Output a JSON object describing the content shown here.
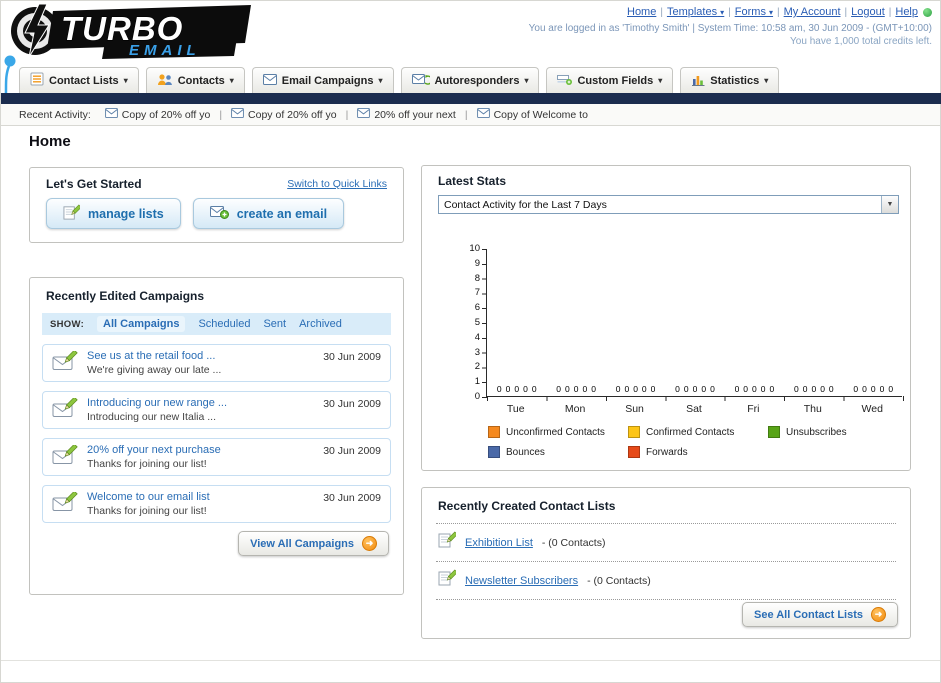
{
  "colors": {
    "navbar_dark": "#1b2c4e",
    "link_blue": "#2a6db5",
    "accent_orange": "#f28b0e",
    "filter_bar_bg": "#d9ecf9",
    "panel_border": "#c2c2be"
  },
  "icons": {
    "caret_down": "▾",
    "select_arrow": "▼",
    "arrow_right": "➜",
    "pipe": "|"
  },
  "header": {
    "logo_top": "TURBO",
    "logo_bottom": "EMAIL",
    "links": [
      "Home",
      "Templates",
      "Forms",
      "My Account",
      "Logout",
      "Help"
    ],
    "login_status": "You are logged in as 'Timothy Smith' | System Time: 10:58 am, 30 Jun 2009 - (GMT+10:00)",
    "credits": "You have 1,000 total credits left."
  },
  "nav": {
    "tabs": [
      {
        "label": "Contact Lists"
      },
      {
        "label": "Contacts"
      },
      {
        "label": "Email Campaigns"
      },
      {
        "label": "Autoresponders"
      },
      {
        "label": "Custom Fields"
      },
      {
        "label": "Statistics"
      }
    ]
  },
  "recent_activity": {
    "label": "Recent Activity:",
    "items": [
      {
        "text": "Copy of 20% off yo"
      },
      {
        "text": "Copy of 20% off yo"
      },
      {
        "text": "20% off your next"
      },
      {
        "text": "Copy of Welcome to"
      }
    ]
  },
  "page": {
    "title": "Home"
  },
  "get_started": {
    "title": "Let's Get Started",
    "switch_link": "Switch to Quick Links",
    "manage_lists_button": "manage lists",
    "create_email_button": "create an email"
  },
  "campaigns": {
    "title": "Recently Edited Campaigns",
    "show_label": "SHOW:",
    "filters": [
      "All Campaigns",
      "Scheduled",
      "Sent",
      "Archived"
    ],
    "items": [
      {
        "title": "See us at the retail food ...",
        "subtitle": "We're giving away our late ...",
        "date": "30 Jun 2009"
      },
      {
        "title": "Introducing our new range ...",
        "subtitle": "Introducing our new Italia ...",
        "date": "30 Jun 2009"
      },
      {
        "title": "20% off your next purchase",
        "subtitle": "Thanks for joining our list!",
        "date": "30 Jun 2009"
      },
      {
        "title": "Welcome to our email list",
        "subtitle": "Thanks for joining our list!",
        "date": "30 Jun 2009"
      }
    ],
    "view_all_button": "View All Campaigns"
  },
  "stats": {
    "title": "Latest Stats",
    "dropdown_value": "Contact Activity for the Last 7 Days"
  },
  "chart_data": {
    "type": "bar",
    "title": "Contact Activity for the Last 7 Days",
    "categories": [
      "Tue",
      "Mon",
      "Sun",
      "Sat",
      "Fri",
      "Thu",
      "Wed"
    ],
    "series": [
      {
        "name": "Unconfirmed Contacts",
        "color": "#f5891f",
        "values": [
          0,
          0,
          0,
          0,
          0,
          0,
          0
        ]
      },
      {
        "name": "Confirmed Contacts",
        "color": "#fdc517",
        "values": [
          0,
          0,
          0,
          0,
          0,
          0,
          0
        ]
      },
      {
        "name": "Unsubscribes",
        "color": "#58a417",
        "values": [
          0,
          0,
          0,
          0,
          0,
          0,
          0
        ]
      },
      {
        "name": "Bounces",
        "color": "#4a69a8",
        "values": [
          0,
          0,
          0,
          0,
          0,
          0,
          0
        ]
      },
      {
        "name": "Forwards",
        "color": "#e64a19",
        "values": [
          0,
          0,
          0,
          0,
          0,
          0,
          0
        ]
      }
    ],
    "xlabel": "",
    "ylabel": "",
    "ylim": [
      0,
      10
    ],
    "ytick_step": 1,
    "grid": false,
    "legend_position": "bottom",
    "value_labels_shown": true
  },
  "contact_lists": {
    "title": "Recently Created Contact Lists",
    "items": [
      {
        "name": "Exhibition List",
        "suffix": "- (0 Contacts)"
      },
      {
        "name": "Newsletter Subscribers",
        "suffix": "- (0 Contacts)"
      }
    ],
    "see_all_button": "See All Contact Lists"
  }
}
